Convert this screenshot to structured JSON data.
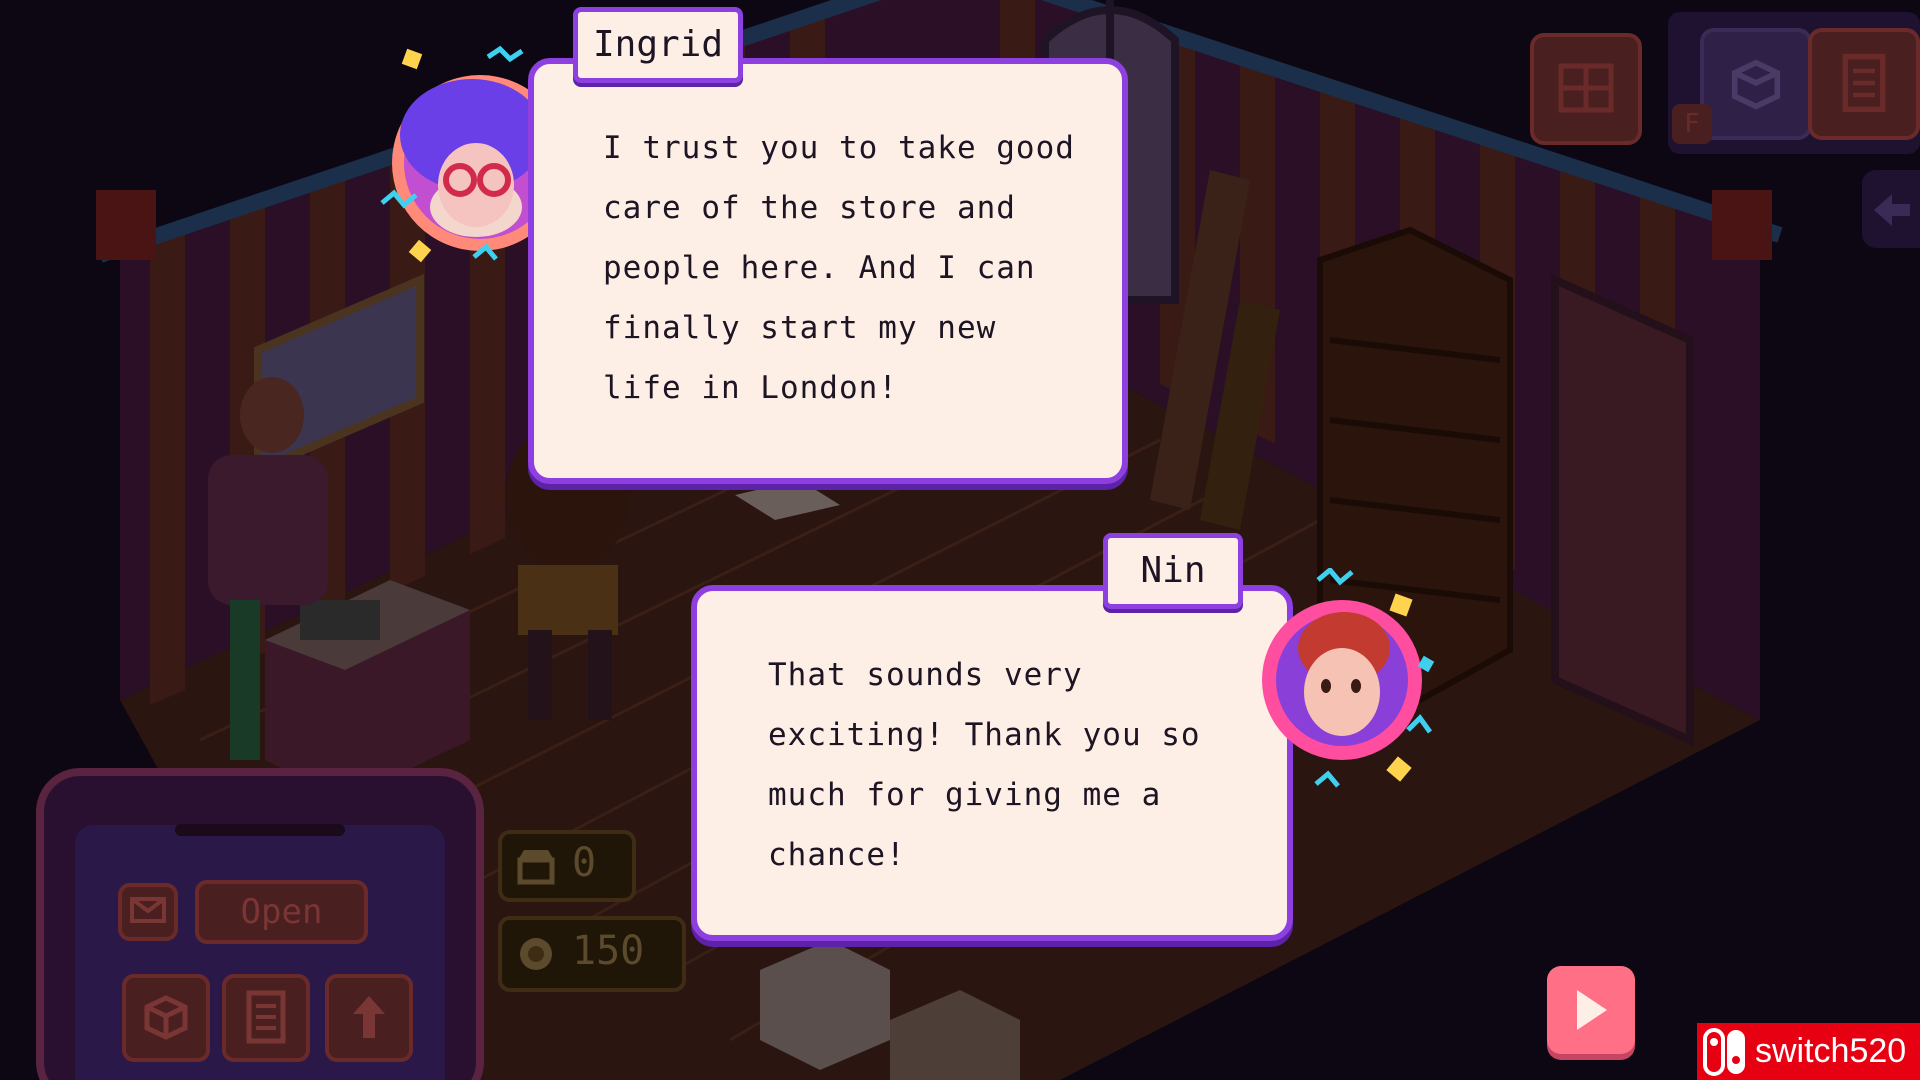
{
  "dialogue": {
    "speaker_top": {
      "name": "Ingrid",
      "text": "I trust you to take good\ncare of the store and\npeople here. And I can\nfinally start my new\nlife in London!"
    },
    "speaker_bottom": {
      "name": "Nin",
      "text": "That sounds very\nexciting! Thank you so\nmuch for giving me a\nchance!"
    }
  },
  "hud": {
    "phone_open_label": "Open",
    "customers_count": "0",
    "coins": "150",
    "hotkey_label": "F"
  },
  "watermark": "switch520",
  "icons": {
    "continue": "play-icon",
    "mail": "mail-icon",
    "box": "box-icon",
    "list": "list-icon",
    "upgrade": "arrow-up-icon",
    "store": "store-icon",
    "coin": "coin-icon",
    "back": "arrow-left-icon"
  },
  "colors": {
    "dialog_border": "#8d3fe0",
    "dialog_bg": "#fdefe6",
    "continue_button": "#ff6f86"
  }
}
